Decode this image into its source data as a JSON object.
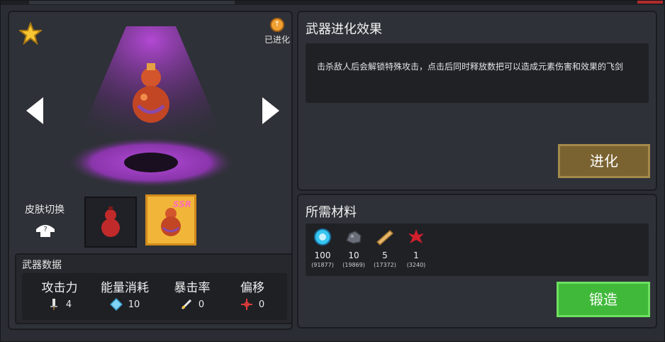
{
  "evolved_badge": {
    "label": "已进化"
  },
  "skin": {
    "label": "皮肤切换",
    "ssr_tag": "SSR"
  },
  "stats": {
    "title": "武器数据",
    "items": [
      {
        "name": "攻击力",
        "value": "4",
        "icon": "sword-icon"
      },
      {
        "name": "能量消耗",
        "value": "10",
        "icon": "diamond-energy-icon"
      },
      {
        "name": "暴击率",
        "value": "0",
        "icon": "crit-dagger-icon"
      },
      {
        "name": "偏移",
        "value": "0",
        "icon": "crosshair-icon"
      }
    ]
  },
  "evolution": {
    "title": "武器进化效果",
    "description": "击杀敌人后会解锁特殊攻击，点击后同时释放数把可以造成元素伤害和效果的飞剑",
    "button": "进化"
  },
  "materials": {
    "title": "所需材料",
    "items": [
      {
        "icon": "blue-gem-icon",
        "count": "100",
        "owned": "(91877)"
      },
      {
        "icon": "ore-rock-icon",
        "count": "10",
        "owned": "(19869)"
      },
      {
        "icon": "wood-plank-icon",
        "count": "5",
        "owned": "(17372)"
      },
      {
        "icon": "red-leaf-icon",
        "count": "1",
        "owned": "(3240)"
      }
    ],
    "button": "锻造"
  },
  "colors": {
    "evolve_button": "#7a6330",
    "forge_button": "#40b93a",
    "spotlight": "#a23cc8"
  }
}
